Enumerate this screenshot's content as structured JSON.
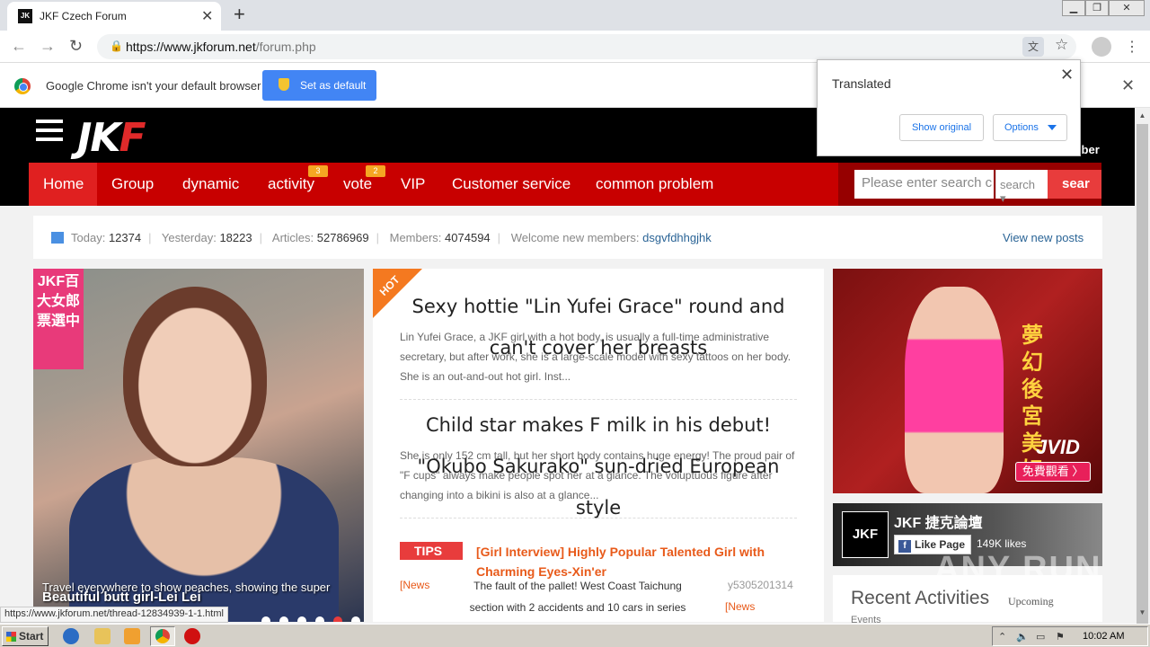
{
  "browser": {
    "tab_title": "JKF Czech Forum",
    "tab_favicon": "JK",
    "new_tab_label": "+",
    "url_scheme_host": "https://www.jkforum.net",
    "url_path": "/forum.php"
  },
  "infobar": {
    "message": "Google Chrome isn't your default browser",
    "button_label": "Set as default"
  },
  "translate_popup": {
    "title": "Translated",
    "show_original": "Show original",
    "options": "Options"
  },
  "site": {
    "logo_main": "JK",
    "logo_accent": "F",
    "member_text": "mber",
    "nav": [
      {
        "label": "Home",
        "badge": ""
      },
      {
        "label": "Group",
        "badge": ""
      },
      {
        "label": "dynamic",
        "badge": ""
      },
      {
        "label": "activity",
        "badge": "3"
      },
      {
        "label": "vote",
        "badge": "2"
      },
      {
        "label": "VIP",
        "badge": ""
      },
      {
        "label": "Customer service",
        "badge": ""
      },
      {
        "label": "common problem",
        "badge": ""
      }
    ],
    "search_placeholder": "Please enter search c",
    "search_select": "search",
    "search_button": "sear"
  },
  "stats": {
    "today_label": "Today:",
    "today": "12374",
    "yesterday_label": "Yesterday:",
    "yesterday": "18223",
    "articles_label": "Articles:",
    "articles": "52786969",
    "members_label": "Members:",
    "members": "4074594",
    "welcome_label": "Welcome new members:",
    "welcome_member": "dsgvfdhhgjhk",
    "view_new_posts": "View new posts"
  },
  "slider": {
    "ribbon_text": "JKF百大女郎票選中",
    "caption": "Travel everywhere to show peaches, showing the super",
    "title": "Beautiful butt girl-Lei Lei",
    "active_dot": 4
  },
  "center": {
    "hot_label": "HOT",
    "articles": [
      {
        "title": "Sexy hottie \"Lin Yufei Grace\" round and can't cover her breasts",
        "body": "Lin Yufei Grace, a JKF girl with a hot body, is usually a full-time administrative secretary, but after work, she is a large-scale model with sexy tattoos on her body. She is an out-and-out hot girl. Inst..."
      },
      {
        "title": "Child star makes F milk in his debut! \"Okubo Sakurako\" sun-dried European style",
        "body": "She is only 152 cm tall, but her short body contains huge energy! The proud pair of \"F cups\" always make people spot her at a glance. The voluptuous figure after changing into a bikini is also at a glance..."
      }
    ],
    "tips_label": "TIPS",
    "tips_link": "[Girl Interview] Highly Popular Talented Girl with Charming Eyes-Xin'er",
    "news_tag": "[News",
    "news_text": "The fault of the pallet! West Coast Taichung section with 2 accidents and 10 cars in series",
    "news_user": "y5305201314",
    "news_tag2": "[News"
  },
  "sidebar": {
    "ad_cn": "夢幻後宮美妃",
    "ad_brand": "JVID",
    "ad_button": "免費觀看 〉",
    "fb_logo": "JKF",
    "fb_name": "JKF 捷克論壇",
    "fb_like": "Like Page",
    "fb_likes": "149K likes",
    "recent_title": "Recent Activities",
    "upcoming": "Upcoming",
    "events": "Events"
  },
  "watermark": "ANY RUN",
  "status_url": "https://www.jkforum.net/thread-12834939-1-1.html",
  "taskbar": {
    "start_label": "Start",
    "clock": "10:02 AM"
  }
}
